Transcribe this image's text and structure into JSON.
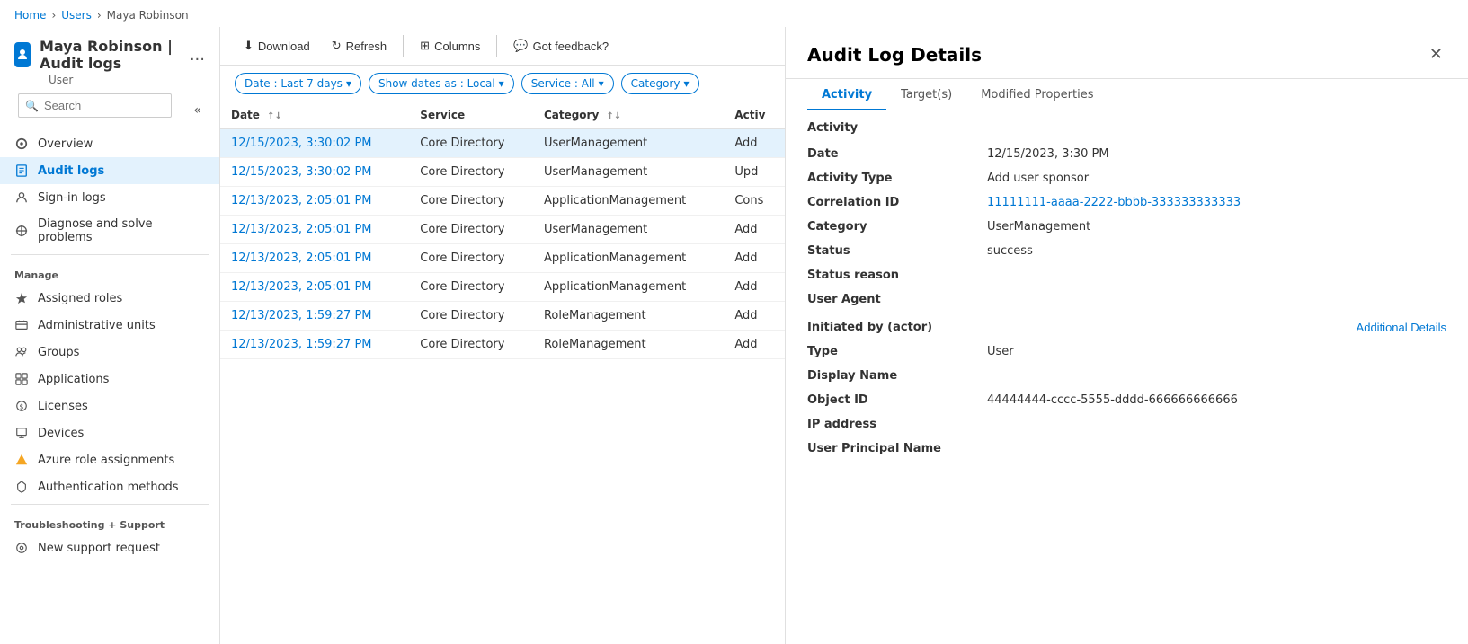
{
  "breadcrumb": {
    "items": [
      "Home",
      "Users",
      "Maya Robinson"
    ]
  },
  "sidebar": {
    "icon_label": "user-page-icon",
    "title": "Maya Robinson | Audit logs",
    "subtitle": "User",
    "more_label": "...",
    "search_placeholder": "Search",
    "collapse_label": "«",
    "nav_items": [
      {
        "id": "overview",
        "label": "Overview",
        "icon": "overview-icon"
      },
      {
        "id": "audit-logs",
        "label": "Audit logs",
        "icon": "audit-icon",
        "active": true
      },
      {
        "id": "sign-in-logs",
        "label": "Sign-in logs",
        "icon": "signin-icon"
      },
      {
        "id": "diagnose",
        "label": "Diagnose and solve problems",
        "icon": "diagnose-icon"
      }
    ],
    "manage_label": "Manage",
    "manage_items": [
      {
        "id": "assigned-roles",
        "label": "Assigned roles",
        "icon": "role-icon"
      },
      {
        "id": "admin-units",
        "label": "Administrative units",
        "icon": "admin-icon"
      },
      {
        "id": "groups",
        "label": "Groups",
        "icon": "groups-icon"
      },
      {
        "id": "applications",
        "label": "Applications",
        "icon": "app-icon"
      },
      {
        "id": "licenses",
        "label": "Licenses",
        "icon": "license-icon"
      },
      {
        "id": "devices",
        "label": "Devices",
        "icon": "device-icon"
      },
      {
        "id": "azure-roles",
        "label": "Azure role assignments",
        "icon": "azure-icon"
      },
      {
        "id": "auth-methods",
        "label": "Authentication methods",
        "icon": "auth-icon"
      }
    ],
    "support_label": "Troubleshooting + Support",
    "support_items": [
      {
        "id": "new-support",
        "label": "New support request",
        "icon": "support-icon"
      }
    ]
  },
  "toolbar": {
    "download_label": "Download",
    "refresh_label": "Refresh",
    "columns_label": "Columns",
    "feedback_label": "Got feedback?"
  },
  "filters": {
    "date_label": "Date : Last 7 days",
    "showdates_label": "Show dates as : Local",
    "service_label": "Service : All",
    "category_label": "Category"
  },
  "table": {
    "columns": [
      "Date",
      "Service",
      "Category",
      "Activ"
    ],
    "rows": [
      {
        "date": "12/15/2023, 3:30:02 PM",
        "service": "Core Directory",
        "category": "UserManagement",
        "activity": "Add",
        "selected": true
      },
      {
        "date": "12/15/2023, 3:30:02 PM",
        "service": "Core Directory",
        "category": "UserManagement",
        "activity": "Upd",
        "selected": false
      },
      {
        "date": "12/13/2023, 2:05:01 PM",
        "service": "Core Directory",
        "category": "ApplicationManagement",
        "activity": "Cons",
        "selected": false
      },
      {
        "date": "12/13/2023, 2:05:01 PM",
        "service": "Core Directory",
        "category": "UserManagement",
        "activity": "Add",
        "selected": false
      },
      {
        "date": "12/13/2023, 2:05:01 PM",
        "service": "Core Directory",
        "category": "ApplicationManagement",
        "activity": "Add",
        "selected": false
      },
      {
        "date": "12/13/2023, 2:05:01 PM",
        "service": "Core Directory",
        "category": "ApplicationManagement",
        "activity": "Add",
        "selected": false
      },
      {
        "date": "12/13/2023, 1:59:27 PM",
        "service": "Core Directory",
        "category": "RoleManagement",
        "activity": "Add",
        "selected": false
      },
      {
        "date": "12/13/2023, 1:59:27 PM",
        "service": "Core Directory",
        "category": "RoleManagement",
        "activity": "Add",
        "selected": false
      }
    ]
  },
  "detail_panel": {
    "title": "Audit Log Details",
    "tabs": [
      {
        "id": "activity",
        "label": "Activity",
        "active": true
      },
      {
        "id": "targets",
        "label": "Target(s)",
        "active": false
      },
      {
        "id": "modified",
        "label": "Modified Properties",
        "active": false
      }
    ],
    "section_label": "Activity",
    "fields": [
      {
        "label": "Date",
        "value": "12/15/2023, 3:30 PM",
        "type": "normal"
      },
      {
        "label": "Activity Type",
        "value": "Add user sponsor",
        "type": "normal"
      },
      {
        "label": "Correlation ID",
        "value": "11111111-aaaa-2222-bbbb-333333333333",
        "type": "link"
      },
      {
        "label": "Category",
        "value": "UserManagement",
        "type": "normal"
      },
      {
        "label": "Status",
        "value": "success",
        "type": "normal"
      },
      {
        "label": "Status reason",
        "value": "",
        "type": "normal"
      },
      {
        "label": "User Agent",
        "value": "",
        "type": "normal"
      }
    ],
    "actor_section": "Initiated by (actor)",
    "additional_details_label": "Additional Details",
    "actor_fields": [
      {
        "label": "Type",
        "value": "User",
        "type": "normal"
      },
      {
        "label": "Display Name",
        "value": "",
        "type": "normal"
      },
      {
        "label": "Object ID",
        "value": "44444444-cccc-5555-dddd-666666666666",
        "type": "normal"
      },
      {
        "label": "IP address",
        "value": "",
        "type": "normal"
      },
      {
        "label": "User Principal Name",
        "value": "",
        "type": "normal"
      }
    ]
  }
}
